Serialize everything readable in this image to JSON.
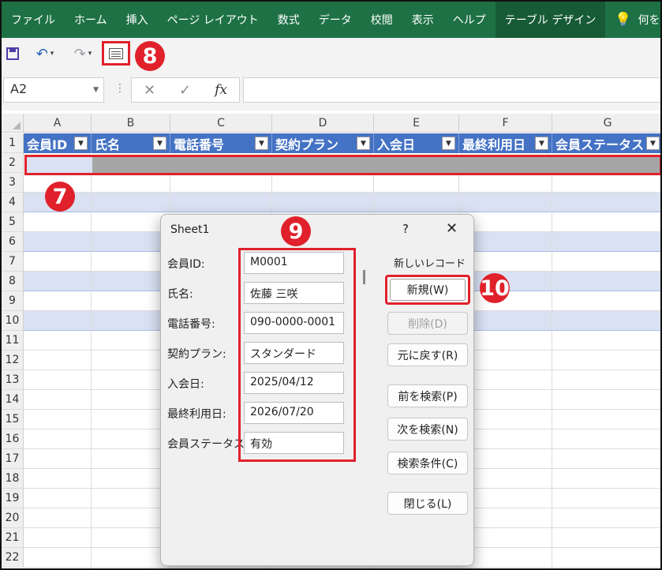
{
  "ribbon": {
    "tabs": [
      "ファイル",
      "ホーム",
      "挿入",
      "ページ レイアウト",
      "数式",
      "データ",
      "校閲",
      "表示",
      "ヘルプ",
      "テーブル デザイン"
    ],
    "active_tab": "テーブル デザイン",
    "search_text": "何をしま"
  },
  "formula_bar": {
    "name_box": "A2",
    "fx": "fx",
    "content": ""
  },
  "grid": {
    "columns": [
      "A",
      "B",
      "C",
      "D",
      "E",
      "F",
      "G"
    ],
    "rows": [
      "1",
      "2",
      "3",
      "4",
      "5",
      "6",
      "7",
      "8",
      "9",
      "10",
      "11",
      "12",
      "13",
      "14",
      "15",
      "16",
      "17",
      "18",
      "19",
      "20",
      "21",
      "22"
    ],
    "table_headers": [
      "会員ID",
      "氏名",
      "電話番号",
      "契約プラン",
      "入会日",
      "最終利用日",
      "会員ステータス"
    ]
  },
  "badges": {
    "b7": "7",
    "b8": "8",
    "b9": "9",
    "b10": "10"
  },
  "dialog": {
    "title": "Sheet1",
    "help": "?",
    "close": "✕",
    "record_status": "新しいレコード",
    "fields": [
      {
        "label": "会員ID:",
        "value": "M0001"
      },
      {
        "label": "氏名:",
        "value": "佐藤 三咲"
      },
      {
        "label": "電話番号:",
        "value": "090-0000-0001"
      },
      {
        "label": "契約プラン:",
        "value": "スタンダード"
      },
      {
        "label": "入会日:",
        "value": "2025/04/12"
      },
      {
        "label": "最終利用日:",
        "value": "2026/07/20"
      },
      {
        "label": "会員ステータス:",
        "value": "有効"
      }
    ],
    "buttons": {
      "new": "新規(W)",
      "delete": "削除(D)",
      "restore": "元に戻す(R)",
      "find_prev": "前を検索(P)",
      "find_next": "次を検索(N)",
      "criteria": "検索条件(C)",
      "close": "閉じる(L)"
    }
  }
}
